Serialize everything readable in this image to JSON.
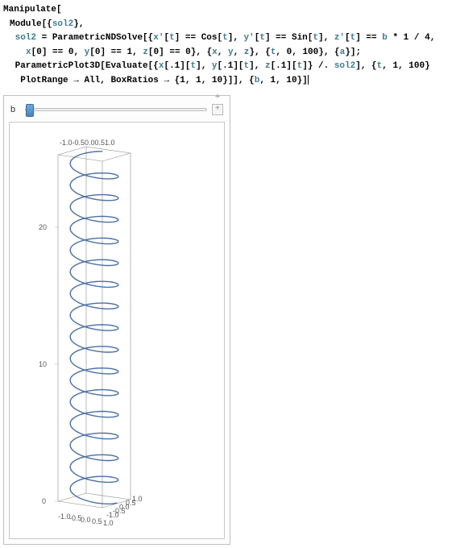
{
  "code": {
    "l1_manipulate": "Manipulate",
    "l2_module": "Module",
    "l2_sol2": "sol2",
    "l3_sol2eq": "sol2",
    "l3_pndsolve": "ParametricNDSolve",
    "l3_xprime": "x'",
    "l3_t": "t",
    "l3_cos": "Cos",
    "l3_yprime": "y'",
    "l3_sin": "Sin",
    "l3_zprime": "z'",
    "l3_b": "b",
    "l3_frac": "1 / 4",
    "l4_x0": "x",
    "l4_zero": "0",
    "l4_eq0a": "0",
    "l4_y0": "y",
    "l4_eq1": "1",
    "l4_z0": "z",
    "l4_eq0b": "0",
    "l4_xyz_x": "x",
    "l4_xyz_y": "y",
    "l4_xyz_z": "z",
    "l4_trange_t": "t",
    "l4_trange_0": "0",
    "l4_trange_100": "100",
    "l4_a": "a",
    "l5_pp3d": "ParametricPlot3D",
    "l5_eval": "Evaluate",
    "l5_x": "x",
    "l5_p1": ".1",
    "l5_y": "y",
    "l5_z": "z",
    "l5_t": "t",
    "l5_repl": "/.",
    "l5_sol2": "sol2",
    "l5_trange_t": "t",
    "l5_trange_1": "1",
    "l5_trange_100": "100",
    "l6_plotrange": "PlotRange",
    "l6_all": "All",
    "l6_boxratios": "BoxRatios",
    "l6_br1": "1",
    "l6_br2": "1",
    "l6_br3": "10",
    "l6_b": "b",
    "l6_b1": "1",
    "l6_b10": "10"
  },
  "control": {
    "label": "b",
    "plus": "+"
  },
  "plot": {
    "z_ticks": [
      "0",
      "10",
      "20"
    ],
    "top_ticks": "-1.0-0.50.00.51.0",
    "bottom_x": [
      "-1.0",
      "-0.5",
      "0.0",
      "0.5",
      "1.0"
    ],
    "bottom_y": [
      "-1.0",
      "-0.5",
      "0.0",
      "0.5",
      "1.0"
    ]
  },
  "chart_data": {
    "type": "line",
    "title": "",
    "description": "3D parametric helix",
    "x_range": [
      -1,
      1
    ],
    "y_range": [
      -1,
      1
    ],
    "z_range": [
      0,
      25
    ],
    "box_ratios": [
      1,
      1,
      10
    ],
    "parametric": {
      "x": "cos(t)",
      "y": "sin(t)",
      "z": "0.25*t",
      "t_range": [
        1,
        100
      ]
    },
    "turns": 16,
    "xlabel": "",
    "ylabel": "",
    "zlabel": ""
  }
}
